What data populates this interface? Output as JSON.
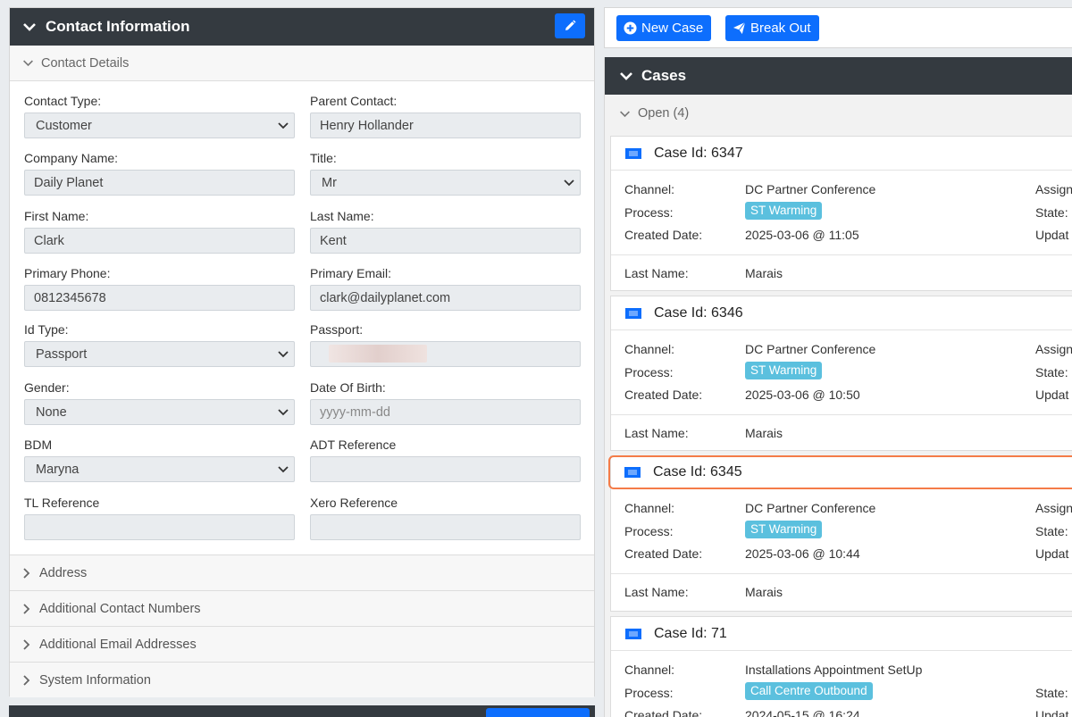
{
  "contact": {
    "header_title": "Contact Information",
    "details_title": "Contact Details",
    "fields": {
      "contact_type": {
        "label": "Contact Type:",
        "value": "Customer"
      },
      "parent_contact": {
        "label": "Parent Contact:",
        "value": "Henry Hollander"
      },
      "company_name": {
        "label": "Company Name:",
        "value": "Daily Planet"
      },
      "title": {
        "label": "Title:",
        "value": "Mr"
      },
      "first_name": {
        "label": "First Name:",
        "value": "Clark"
      },
      "last_name": {
        "label": "Last Name:",
        "value": "Kent"
      },
      "primary_phone": {
        "label": "Primary Phone:",
        "value": "0812345678"
      },
      "primary_email": {
        "label": "Primary Email:",
        "value": "clark@dailyplanet.com"
      },
      "id_type": {
        "label": "Id Type:",
        "value": "Passport"
      },
      "passport": {
        "label": "Passport:",
        "value": ""
      },
      "gender": {
        "label": "Gender:",
        "value": "None"
      },
      "dob": {
        "label": "Date Of Birth:",
        "placeholder": "yyyy-mm-dd"
      },
      "bdm": {
        "label": "BDM",
        "value": "Maryna"
      },
      "adt_reference": {
        "label": "ADT Reference",
        "value": ""
      },
      "tl_reference": {
        "label": "TL Reference",
        "value": ""
      },
      "xero_reference": {
        "label": "Xero Reference",
        "value": ""
      }
    },
    "sections": [
      "Address",
      "Additional Contact Numbers",
      "Additional Email Addresses",
      "System Information"
    ]
  },
  "toolbar": {
    "new_case": "New Case",
    "break_out": "Break Out"
  },
  "cases": {
    "header_title": "Cases",
    "open_label": "Open (4)",
    "labels": {
      "channel": "Channel:",
      "process": "Process:",
      "created": "Created Date:",
      "last_name": "Last Name:",
      "assign": "Assign",
      "state": "State:",
      "updat": "Updat"
    },
    "items": [
      {
        "title": "Case Id: 6347",
        "channel": "DC Partner Conference",
        "process": "ST Warming",
        "created": "2025-03-06 @ 11:05",
        "last_name": "Marais"
      },
      {
        "title": "Case Id: 6346",
        "channel": "DC Partner Conference",
        "process": "ST Warming",
        "created": "2025-03-06 @ 10:50",
        "last_name": "Marais"
      },
      {
        "title": "Case Id: 6345",
        "channel": "DC Partner Conference",
        "process": "ST Warming",
        "created": "2025-03-06 @ 10:44",
        "last_name": "Marais"
      },
      {
        "title": "Case Id: 71",
        "channel": "Installations Appointment SetUp",
        "process": "Call Centre Outbound",
        "created": "2024-05-15 @ 16:24"
      }
    ]
  },
  "colors": {
    "header_dark": "#343a40",
    "primary": "#0d6efd",
    "badge": "#5bc0de",
    "highlight": "#f47c48"
  }
}
